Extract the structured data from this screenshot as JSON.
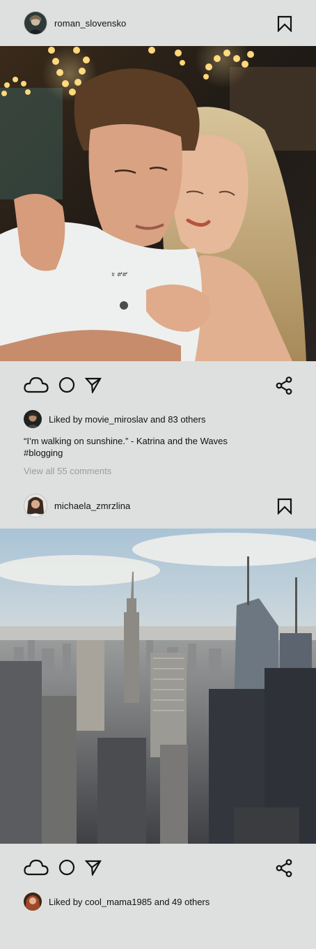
{
  "posts": [
    {
      "username": "roman_slovensko",
      "liked_by_user": "movie_miroslav",
      "likes_text": "Liked by movie_miroslav and 83 others",
      "caption_quote": "“I’m walking on sunshine.” - Katrina and the Waves",
      "caption_tag": "#blogging",
      "comments_link": "View all 55 comments"
    },
    {
      "username": "michaela_zmrzlina",
      "liked_by_user": "cool_mama1985",
      "likes_text": "Liked by cool_mama1985 and 49 others"
    }
  ],
  "icons": {
    "bookmark": "bookmark-icon",
    "like": "cloud-icon",
    "comment": "circle-icon",
    "send": "paper-plane-icon",
    "share": "share-icon"
  },
  "colors": {
    "background": "#dde0df",
    "text": "#111111",
    "muted": "#9a9d9c"
  }
}
